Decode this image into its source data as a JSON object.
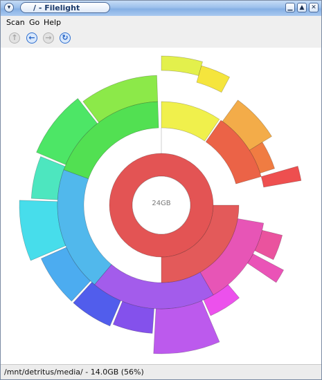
{
  "window": {
    "title": "/ - Filelight"
  },
  "menu": {
    "scan": "Scan",
    "go": "Go",
    "help": "Help"
  },
  "toolbar": {
    "up_icon": "arrow-up-icon",
    "back_icon": "arrow-left-icon",
    "forward_icon": "arrow-right-icon",
    "refresh_icon": "refresh-icon",
    "up_enabled": false,
    "back_enabled": true,
    "forward_enabled": false,
    "refresh_enabled": true
  },
  "center": {
    "label": "24GB"
  },
  "status": {
    "text": "/mnt/detritus/media/ - 14.0GB (56%)"
  }
}
